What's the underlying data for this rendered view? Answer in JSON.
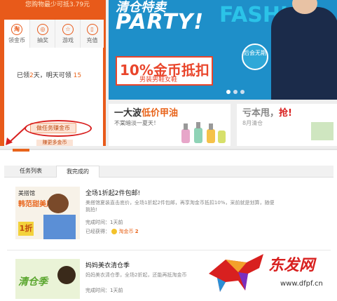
{
  "left": {
    "header_text": "您购物最少可抵3.79元",
    "tabs": [
      {
        "label": "领金币",
        "icon": "淘"
      },
      {
        "label": "抽奖",
        "icon": "◎"
      },
      {
        "label": "游戏",
        "icon": "☆"
      },
      {
        "label": "充值",
        "icon": "▯"
      }
    ],
    "sign_prefix": "已领",
    "sign_days": "2",
    "sign_middle": "天，明天可领",
    "sign_tomorrow": "15",
    "task_button": "做任务赚金币",
    "more_button": "赚更多金币"
  },
  "banner": {
    "top_text": "清仓特卖",
    "party": "PARTY!",
    "pct": "10%金币抵扣",
    "pct_sub": "男装男鞋女鞋",
    "fashion": "FASHIO",
    "badge": "后会无期"
  },
  "promos": [
    {
      "title_a": "一大波",
      "title_b": "低价甲油",
      "sub": "不棠暗淡一夏天！"
    },
    {
      "title_a": "亏本甩，",
      "title_b": "抢!",
      "sub": "8月清仓"
    }
  ],
  "tabs": [
    "任务列表",
    "我完成的"
  ],
  "tasks": [
    {
      "img_text_a": "美搭馆",
      "img_text_b": "韩范甜美风",
      "img_text_c": "1折",
      "title": "全场1折起2件包邮!",
      "desc": "美搭馆夏装直击底价，全场1折起2件包邮，再享淘金币抵扣10%，采前就是划算，随便挑拍!",
      "time_label": "完成时间：",
      "time_value": "1天前",
      "earned_label": "已经获得：",
      "coin_label": "淘金币",
      "coin_value": "2"
    },
    {
      "img_text_a": "清仓季",
      "title": "妈妈美衣清仓季",
      "desc": "妈妈美衣清仓季，全场2折起，还能再抵淘金币",
      "time_label": "完成时间：",
      "time_value": "1天前"
    }
  ],
  "watermark": {
    "text": "东发网",
    "url": "www.dfpf.cn"
  },
  "colors": {
    "accent": "#e85a1a",
    "highlight": "#d8201f",
    "banner": "#1e8fc9"
  }
}
